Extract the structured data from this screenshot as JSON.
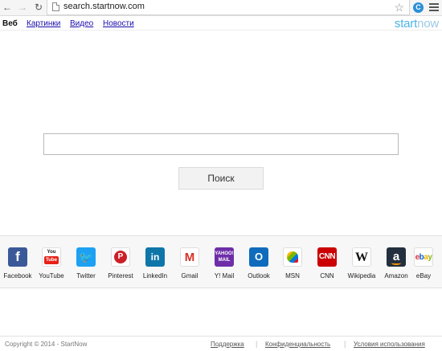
{
  "browser": {
    "url": "search.startnow.com",
    "back_icon": "arrow-left-icon",
    "forward_icon": "arrow-right-icon",
    "reload_icon": "reload-icon",
    "bookmark_icon": "star-icon",
    "extension_icon": "extension-icon",
    "menu_icon": "menu-icon",
    "extension_glyph": "C"
  },
  "nav": {
    "items": [
      {
        "label": "Веб",
        "active": true
      },
      {
        "label": "Картинки",
        "active": false
      },
      {
        "label": "Видео",
        "active": false
      },
      {
        "label": "Новости",
        "active": false
      }
    ],
    "logo_start": "start",
    "logo_now": "now"
  },
  "search": {
    "value": "",
    "button_label": "Поиск"
  },
  "quick_links": [
    {
      "label": "Facebook",
      "icon": "facebook-icon",
      "glyph": "f",
      "color": "#3b5998"
    },
    {
      "label": "YouTube",
      "icon": "youtube-icon",
      "glyph_top": "You",
      "glyph_bottom": "Tube",
      "color": "#e62117"
    },
    {
      "label": "Twitter",
      "icon": "twitter-icon",
      "glyph": "🐦",
      "color": "#1da1f2"
    },
    {
      "label": "Pinterest",
      "icon": "pinterest-icon",
      "glyph": "P",
      "color": "#cb2027"
    },
    {
      "label": "LinkedIn",
      "icon": "linkedin-icon",
      "glyph": "in",
      "color": "#0e76a8"
    },
    {
      "label": "Gmail",
      "icon": "gmail-icon",
      "glyph": "M",
      "color": "#d93025"
    },
    {
      "label": "Y! Mail",
      "icon": "yahoo-mail-icon",
      "glyph_top": "YAHOO!",
      "glyph_bottom": "MAIL",
      "color": "#6e2ea8"
    },
    {
      "label": "Outlook",
      "icon": "outlook-icon",
      "glyph": "O",
      "color": "#0f6cbd"
    },
    {
      "label": "MSN",
      "icon": "msn-icon",
      "color": "#0078d7"
    },
    {
      "label": "CNN",
      "icon": "cnn-icon",
      "glyph": "CNN",
      "color": "#cc0000"
    },
    {
      "label": "Wikipedia",
      "icon": "wikipedia-icon",
      "glyph": "W",
      "color": "#111111"
    },
    {
      "label": "Amazon",
      "icon": "amazon-icon",
      "glyph": "a",
      "color": "#232f3e"
    },
    {
      "label": "eBay",
      "icon": "ebay-icon",
      "glyph": [
        "e",
        "b",
        "a",
        "y"
      ],
      "color": "#e53238"
    }
  ],
  "footer": {
    "copyright": "Copyright © 2014 - StartNow",
    "links": [
      "Поддержка",
      "Конфиденциальность",
      "Условия использования"
    ]
  },
  "colors": {
    "link": "#1a0dab",
    "logo": "#4cb3e6",
    "quickbar_bg": "#f7f7f7"
  }
}
